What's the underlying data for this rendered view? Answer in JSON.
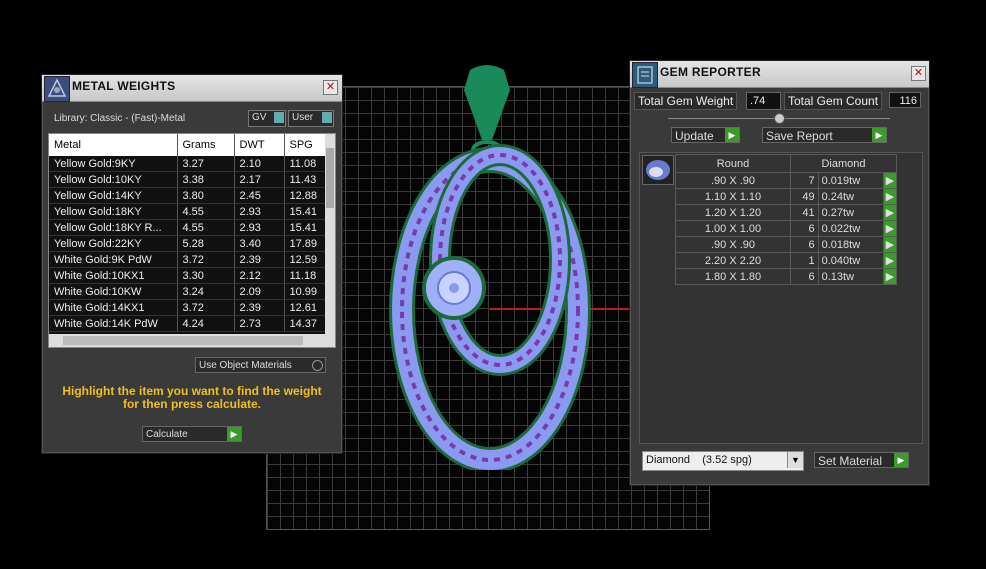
{
  "metal_weights": {
    "title": "METAL WEIGHTS",
    "library": "Library: Classic - (Fast)-Metal",
    "gv_label": "GV",
    "user_label": "User",
    "columns": [
      "Metal",
      "Grams",
      "DWT",
      "SPG"
    ],
    "rows": [
      [
        "Yellow Gold:9KY",
        "3.27",
        "2.10",
        "11.08"
      ],
      [
        "Yellow Gold:10KY",
        "3.38",
        "2.17",
        "11.43"
      ],
      [
        "Yellow Gold:14KY",
        "3.80",
        "2.45",
        "12.88"
      ],
      [
        "Yellow Gold:18KY",
        "4.55",
        "2.93",
        "15.41"
      ],
      [
        "Yellow Gold:18KY R...",
        "4.55",
        "2.93",
        "15.41"
      ],
      [
        "Yellow Gold:22KY",
        "5.28",
        "3.40",
        "17.89"
      ],
      [
        "White Gold:9K PdW",
        "3.72",
        "2.39",
        "12.59"
      ],
      [
        "White Gold:10KX1",
        "3.30",
        "2.12",
        "11.18"
      ],
      [
        "White Gold:10KW",
        "3.24",
        "2.09",
        "10.99"
      ],
      [
        "White Gold:14KX1",
        "3.72",
        "2.39",
        "12.61"
      ],
      [
        "White Gold:14K PdW",
        "4.24",
        "2.73",
        "14.37"
      ]
    ],
    "use_object_materials": "Use Object Materials",
    "instruction": "Highlight the item you want to find the weight for then press calculate.",
    "calculate_label": "Calculate",
    "accent_color": "#f0c020"
  },
  "gem_reporter": {
    "title": "GEM REPORTER",
    "total_weight_label": "Total Gem Weight",
    "total_weight_value": ".74",
    "total_count_label": "Total Gem Count",
    "total_count_value": "116",
    "update_label": "Update",
    "save_report_label": "Save Report",
    "shape_header": "Round",
    "material_header": "Diamond",
    "rows": [
      [
        ".90 X .90",
        "7",
        "0.019tw"
      ],
      [
        "1.10 X 1.10",
        "49",
        "0.24tw"
      ],
      [
        "1.20 X 1.20",
        "41",
        "0.27tw"
      ],
      [
        "1.00 X 1.00",
        "6",
        "0.022tw"
      ],
      [
        ".90 X .90",
        "6",
        "0.018tw"
      ],
      [
        "2.20 X 2.20",
        "1",
        "0.040tw"
      ],
      [
        "1.80 X 1.80",
        "6",
        "0.13tw"
      ]
    ],
    "material_select": "Diamond    (3.52 spg)",
    "set_material_label": "Set Material"
  },
  "icons": {
    "close": "close-icon",
    "arrow": "green-arrow-icon",
    "metal_weights_icon": "scale-icon",
    "gem_reporter_icon": "report-icon",
    "round_gem_icon": "round-gem-icon"
  }
}
